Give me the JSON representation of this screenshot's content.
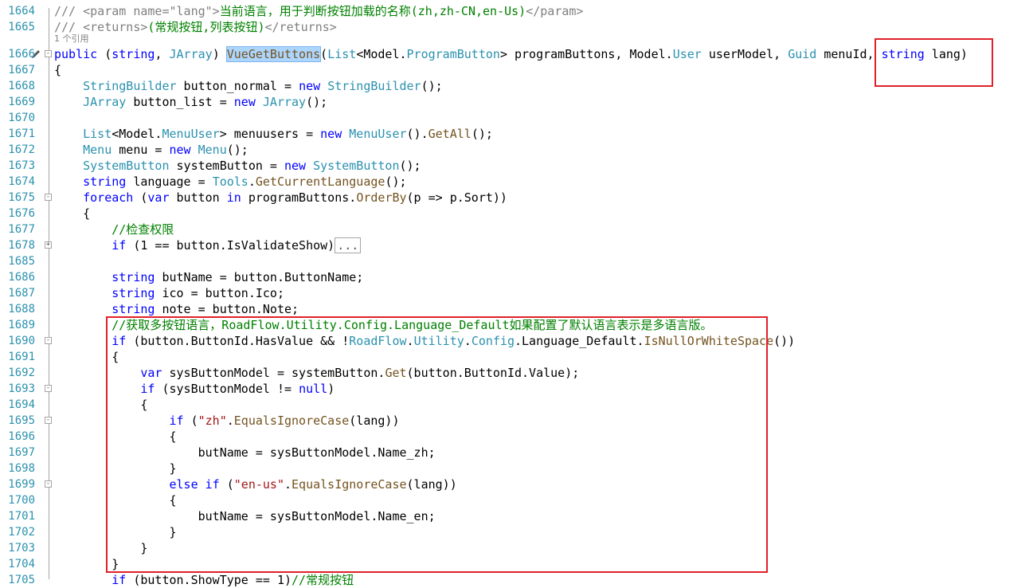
{
  "ref_hint": "1 个引用",
  "lines": [
    {
      "n": "1664",
      "t": "doc1"
    },
    {
      "n": "1665",
      "t": "doc2"
    },
    {
      "n": "1666",
      "t": "sig"
    },
    {
      "n": "1667",
      "t": "{"
    },
    {
      "n": "1668"
    },
    {
      "n": "1669"
    },
    {
      "n": "1670"
    },
    {
      "n": "1671"
    },
    {
      "n": "1672"
    },
    {
      "n": "1673"
    },
    {
      "n": "1674"
    },
    {
      "n": "1675"
    },
    {
      "n": "1676"
    },
    {
      "n": "1677"
    },
    {
      "n": "1678"
    },
    {
      "n": "1685"
    },
    {
      "n": "1686"
    },
    {
      "n": "1687"
    },
    {
      "n": "1688"
    },
    {
      "n": "1689"
    },
    {
      "n": "1690"
    },
    {
      "n": "1691"
    },
    {
      "n": "1692"
    },
    {
      "n": "1693"
    },
    {
      "n": "1694"
    },
    {
      "n": "1695"
    },
    {
      "n": "1696"
    },
    {
      "n": "1697"
    },
    {
      "n": "1698"
    },
    {
      "n": "1699"
    },
    {
      "n": "1700"
    },
    {
      "n": "1701"
    },
    {
      "n": "1702"
    },
    {
      "n": "1703"
    },
    {
      "n": "1704"
    },
    {
      "n": "1705"
    }
  ],
  "code": {
    "l1664": "/// <param name=\"lang\">当前语言，用于判断按钮加载的名称(zh,zh-CN,en-Us)</param>",
    "l1665": "/// <returns>(常规按钮,列表按钮)</returns>",
    "l1666": "public (string, JArray) VueGetButtons(List<Model.ProgramButton> programButtons, Model.User userModel, Guid menuId, string lang)",
    "l1667": "{",
    "l1668": "    StringBuilder button_normal = new StringBuilder();",
    "l1669": "    JArray button_list = new JArray();",
    "l1671": "    List<Model.MenuUser> menuusers = new MenuUser().GetAll();",
    "l1672": "    Menu menu = new Menu();",
    "l1673": "    SystemButton systemButton = new SystemButton();",
    "l1674": "    string language = Tools.GetCurrentLanguage();",
    "l1675": "    foreach (var button in programButtons.OrderBy(p => p.Sort))",
    "l1676": "    {",
    "l1677": "        //检查权限",
    "l1678": "        if (1 == button.IsValidateShow)...",
    "l1686": "        string butName = button.ButtonName;",
    "l1687": "        string ico = button.Ico;",
    "l1688": "        string note = button.Note;",
    "l1689": "        //获取多按钮语言，RoadFlow.Utility.Config.Language_Default如果配置了默认语言表示是多语言版。",
    "l1690": "        if (button.ButtonId.HasValue && !RoadFlow.Utility.Config.Language_Default.IsNullOrWhiteSpace())",
    "l1691": "        {",
    "l1692": "            var sysButtonModel = systemButton.Get(button.ButtonId.Value);",
    "l1693": "            if (sysButtonModel != null)",
    "l1694": "            {",
    "l1695": "                if (\"zh\".EqualsIgnoreCase(lang))",
    "l1696": "                {",
    "l1697": "                    butName = sysButtonModel.Name_zh;",
    "l1698": "                }",
    "l1699": "                else if (\"en-us\".EqualsIgnoreCase(lang))",
    "l1700": "                {",
    "l1701": "                    butName = sysButtonModel.Name_en;",
    "l1702": "                }",
    "l1703": "            }",
    "l1704": "        }",
    "l1705": "        if (button.ShowType == 1)//常规按钮"
  },
  "colors": {
    "keyword": "#0000ff",
    "type": "#2b91af",
    "string": "#a31515",
    "comment": "#008000",
    "doc": "#808080",
    "highlight_box": "#e0202a"
  }
}
